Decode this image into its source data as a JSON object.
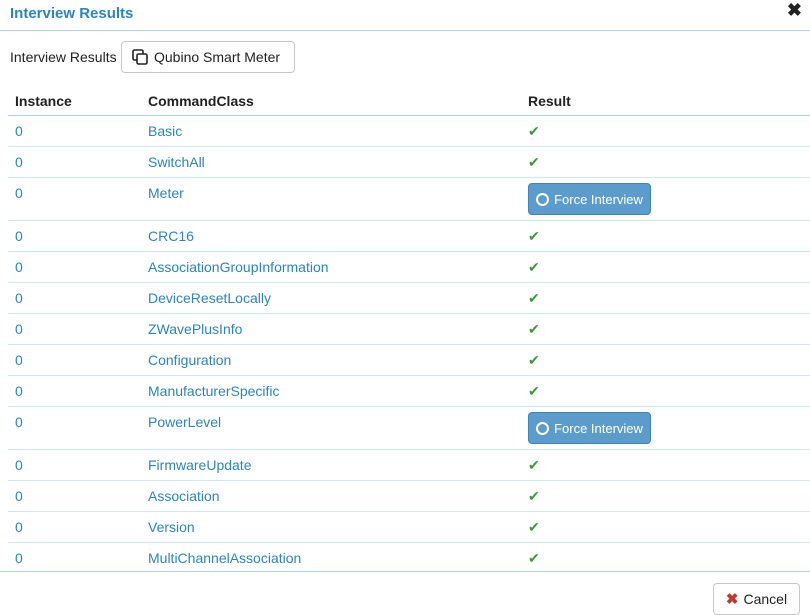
{
  "modal": {
    "title": "Interview Results",
    "close_icon": "close-icon"
  },
  "subheader": {
    "label": "Interview Results",
    "device_button_label": "Qubino Smart Meter",
    "device_icon": "copy-icon"
  },
  "table": {
    "columns": [
      "Instance",
      "CommandClass",
      "Result"
    ],
    "rows": [
      {
        "instance": "0",
        "command_class": "Basic",
        "result": "ok"
      },
      {
        "instance": "0",
        "command_class": "SwitchAll",
        "result": "ok"
      },
      {
        "instance": "0",
        "command_class": "Meter",
        "result": "force"
      },
      {
        "instance": "0",
        "command_class": "CRC16",
        "result": "ok"
      },
      {
        "instance": "0",
        "command_class": "AssociationGroupInformation",
        "result": "ok"
      },
      {
        "instance": "0",
        "command_class": "DeviceResetLocally",
        "result": "ok"
      },
      {
        "instance": "0",
        "command_class": "ZWavePlusInfo",
        "result": "ok"
      },
      {
        "instance": "0",
        "command_class": "Configuration",
        "result": "ok"
      },
      {
        "instance": "0",
        "command_class": "ManufacturerSpecific",
        "result": "ok"
      },
      {
        "instance": "0",
        "command_class": "PowerLevel",
        "result": "force"
      },
      {
        "instance": "0",
        "command_class": "FirmwareUpdate",
        "result": "ok"
      },
      {
        "instance": "0",
        "command_class": "Association",
        "result": "ok"
      },
      {
        "instance": "0",
        "command_class": "Version",
        "result": "ok"
      },
      {
        "instance": "0",
        "command_class": "MultiChannelAssociation",
        "result": "ok"
      }
    ],
    "force_button_label": "Force Interview",
    "ok_icon": "check-icon"
  },
  "footer": {
    "cancel_label": "Cancel",
    "cancel_icon": "x-icon"
  },
  "colors": {
    "link": "#2a85c0",
    "check": "#3c9a3c",
    "force_button": "#5b9ccc",
    "cancel_x": "#c0392b"
  }
}
